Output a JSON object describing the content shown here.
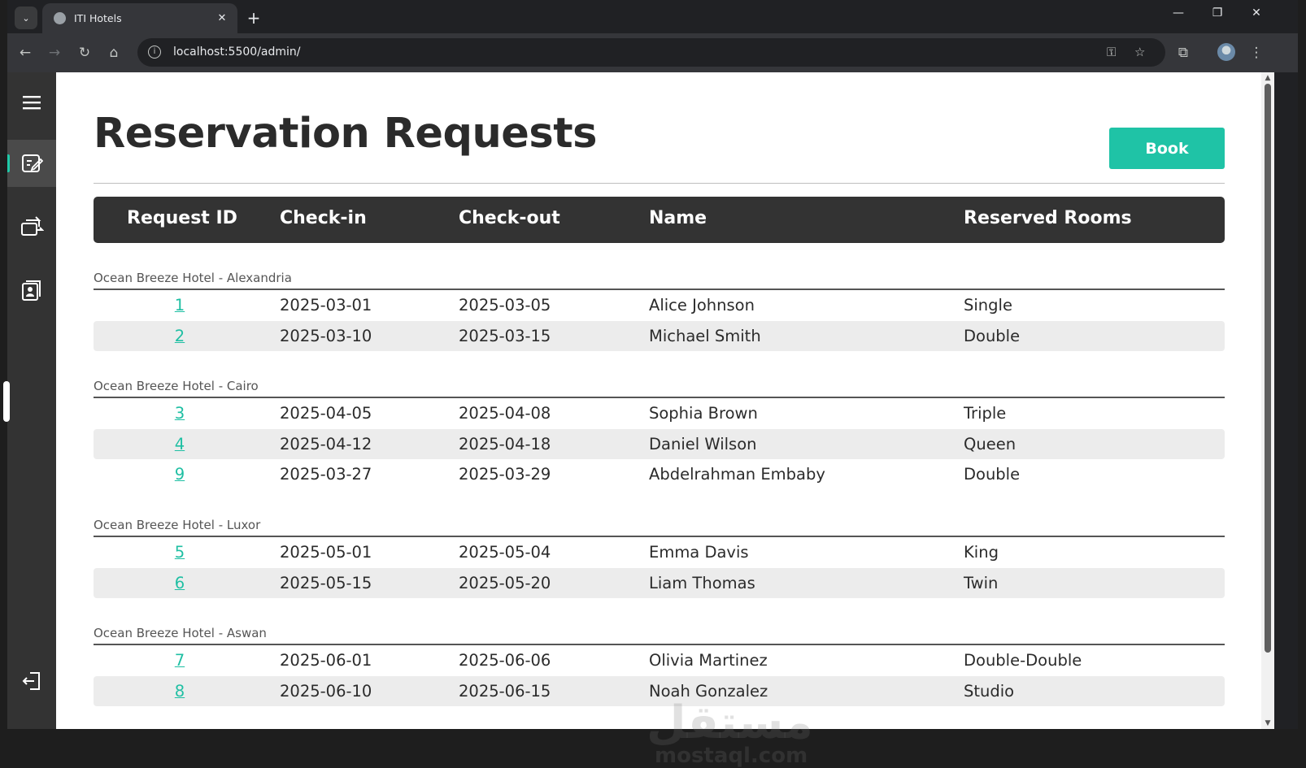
{
  "browser": {
    "tab_title": "ITI Hotels",
    "url": "localhost:5500/admin/",
    "tab_close": "✕",
    "new_tab": "+",
    "dropdown": "⌄"
  },
  "window_controls": {
    "minimize": "—",
    "restore": "❐",
    "close": "✕"
  },
  "sidebar": {
    "items": [
      {
        "name": "menu",
        "icon": "hamburger-icon"
      },
      {
        "name": "reservation-requests",
        "icon": "edit-document-icon",
        "active": true
      },
      {
        "name": "rooms",
        "icon": "room-swap-icon"
      },
      {
        "name": "contacts",
        "icon": "contact-card-icon"
      },
      {
        "name": "logout",
        "icon": "logout-icon"
      }
    ]
  },
  "page": {
    "title": "Reservation Requests",
    "book_label": "Book"
  },
  "table": {
    "headers": [
      "Request ID",
      "Check-in",
      "Check-out",
      "Name",
      "Reserved Rooms"
    ],
    "groups": [
      {
        "hotel": "Ocean Breeze Hotel - Alexandria",
        "rows": [
          {
            "id": "1",
            "check_in": "2025-03-01",
            "check_out": "2025-03-05",
            "name": "Alice Johnson",
            "rooms": "Single"
          },
          {
            "id": "2",
            "check_in": "2025-03-10",
            "check_out": "2025-03-15",
            "name": "Michael Smith",
            "rooms": "Double"
          }
        ]
      },
      {
        "hotel": "Ocean Breeze Hotel - Cairo",
        "rows": [
          {
            "id": "3",
            "check_in": "2025-04-05",
            "check_out": "2025-04-08",
            "name": "Sophia Brown",
            "rooms": "Triple"
          },
          {
            "id": "4",
            "check_in": "2025-04-12",
            "check_out": "2025-04-18",
            "name": "Daniel Wilson",
            "rooms": "Queen"
          },
          {
            "id": "9",
            "check_in": "2025-03-27",
            "check_out": "2025-03-29",
            "name": "Abdelrahman Embaby",
            "rooms": "Double"
          }
        ]
      },
      {
        "hotel": "Ocean Breeze Hotel - Luxor",
        "rows": [
          {
            "id": "5",
            "check_in": "2025-05-01",
            "check_out": "2025-05-04",
            "name": "Emma Davis",
            "rooms": "King"
          },
          {
            "id": "6",
            "check_in": "2025-05-15",
            "check_out": "2025-05-20",
            "name": "Liam Thomas",
            "rooms": "Twin"
          }
        ]
      },
      {
        "hotel": "Ocean Breeze Hotel - Aswan",
        "rows": [
          {
            "id": "7",
            "check_in": "2025-06-01",
            "check_out": "2025-06-06",
            "name": "Olivia Martinez",
            "rooms": "Double-Double"
          },
          {
            "id": "8",
            "check_in": "2025-06-10",
            "check_out": "2025-06-15",
            "name": "Noah Gonzalez",
            "rooms": "Studio"
          }
        ]
      }
    ]
  },
  "watermark": {
    "arabic": "مستقل",
    "latin": "mostaql.com"
  },
  "colors": {
    "accent": "#1fc3a6",
    "header_bg": "#333333",
    "sidebar_bg": "#333333",
    "row_alt": "#ececec"
  }
}
